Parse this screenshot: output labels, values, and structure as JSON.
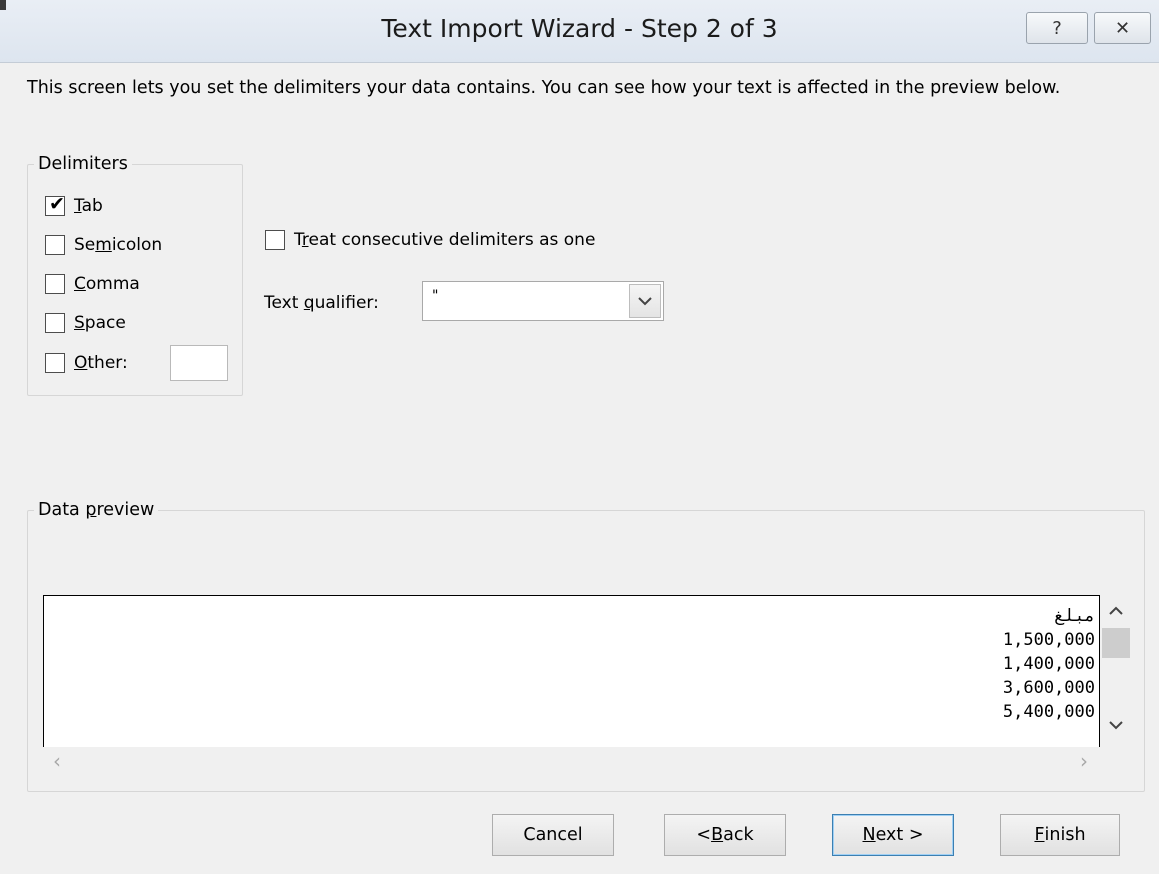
{
  "window": {
    "title": "Text Import Wizard - Step 2 of 3",
    "help_glyph": "?",
    "close_glyph": "✕"
  },
  "description": "This screen lets you set the delimiters your data contains.  You can see how your text is affected in the preview below.",
  "delimiters": {
    "legend": "Delimiters",
    "tab": {
      "accel": "T",
      "rest": "ab",
      "checked": true
    },
    "semicolon": {
      "pre": "Se",
      "accel": "m",
      "rest": "icolon",
      "checked": false
    },
    "comma": {
      "accel": "C",
      "rest": "omma",
      "checked": false
    },
    "space": {
      "accel": "S",
      "rest": "pace",
      "checked": false
    },
    "other": {
      "accel": "O",
      "rest": "ther:",
      "checked": false,
      "value": ""
    }
  },
  "consecutive": {
    "pre": "T",
    "accel": "r",
    "rest": "eat consecutive delimiters as one",
    "checked": false
  },
  "qualifier": {
    "pre": "Text ",
    "accel": "q",
    "rest": "ualifier:",
    "value": "\""
  },
  "preview": {
    "legend_pre": "Data ",
    "legend_accel": "p",
    "legend_rest": "review",
    "lines": [
      "مبلغ",
      "1,500,000",
      "1,400,000",
      "3,600,000",
      "5,400,000"
    ]
  },
  "buttons": {
    "cancel": "Cancel",
    "back_pre": "< ",
    "back_accel": "B",
    "back_rest": "ack",
    "next_accel": "N",
    "next_rest": "ext >",
    "finish_accel": "F",
    "finish_rest": "inish"
  }
}
